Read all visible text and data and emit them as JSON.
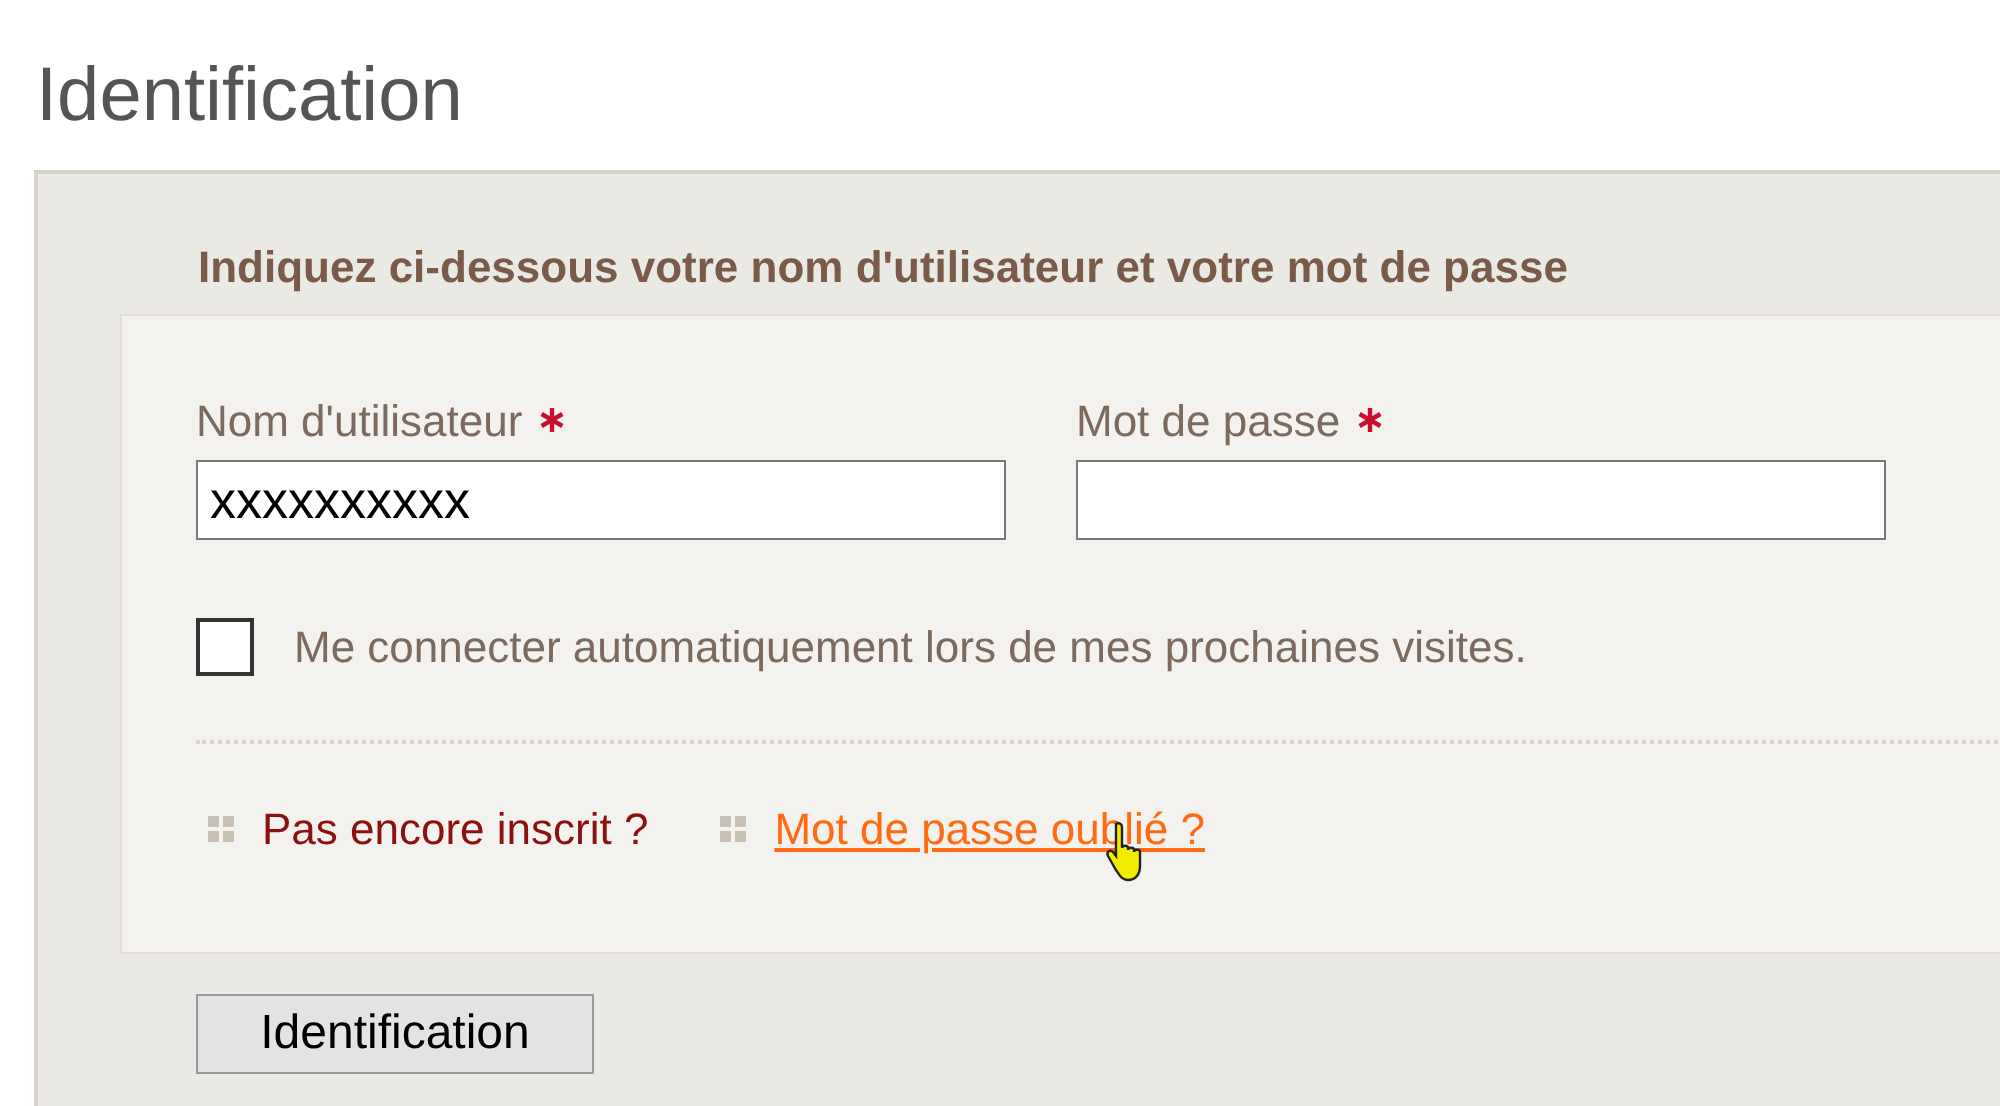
{
  "title": "Identification",
  "intro": "Indiquez ci-dessous votre nom d'utilisateur et votre mot de passe",
  "fields": [
    {
      "label": "Nom d'utilisateur",
      "required": true,
      "value": "xxxxxxxxxx"
    },
    {
      "label": "Mot de passe",
      "required": true
    }
  ],
  "remember": {
    "label": "Me connecter automatiquement lors de mes prochaines visites.",
    "checked": false
  },
  "links": [
    {
      "label": "Pas encore inscrit ?",
      "kind": "text"
    },
    {
      "label": "Mot de passe oublié ?",
      "kind": "link"
    }
  ],
  "button": "Identification"
}
